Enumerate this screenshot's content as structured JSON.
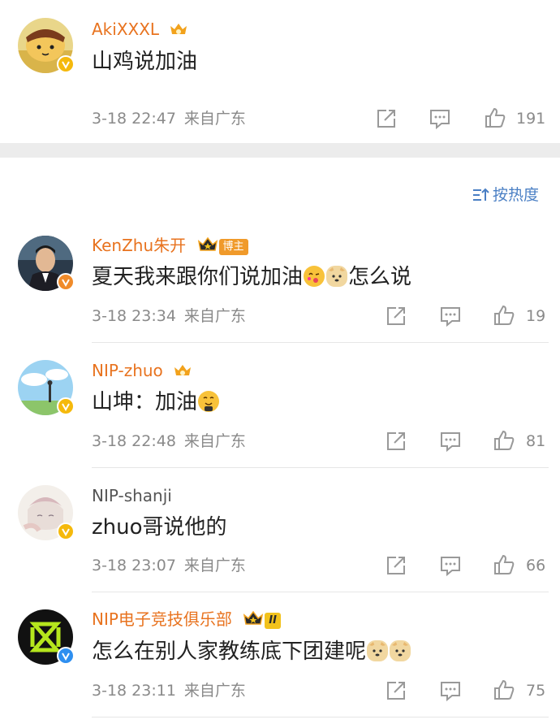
{
  "top_comment": {
    "username": "AkiXXXL",
    "text": "山鸡说加油",
    "time": "3-18 22:47",
    "location": "来自广东",
    "likes": "191"
  },
  "sort": {
    "label": "按热度"
  },
  "comments": [
    {
      "username": "KenZhu朱开",
      "badge": "博主",
      "text": "夏天我来跟你们说加油",
      "text_after": "怎么说",
      "time": "3-18 23:34",
      "location": "来自广东",
      "likes": "19"
    },
    {
      "username": "NIP-zhuo",
      "text": "山坤：加油",
      "time": "3-18 22:48",
      "location": "来自广东",
      "likes": "81"
    },
    {
      "username": "NIP-shanji",
      "text": "zhuo哥说他的",
      "time": "3-18 23:07",
      "location": "来自广东",
      "likes": "66"
    },
    {
      "username": "NIP电子竞技俱乐部",
      "level": "II",
      "text": "怎么在别人家教练底下团建呢",
      "time": "3-18 23:11",
      "location": "来自广东",
      "likes": "75"
    }
  ],
  "colors": {
    "username_orange": "#e8731f",
    "meta_grey": "#8a8a8a",
    "sort_blue": "#4a7fc4",
    "verified_gold": "#f5b90c",
    "verified_blue": "#2e8ff0"
  }
}
